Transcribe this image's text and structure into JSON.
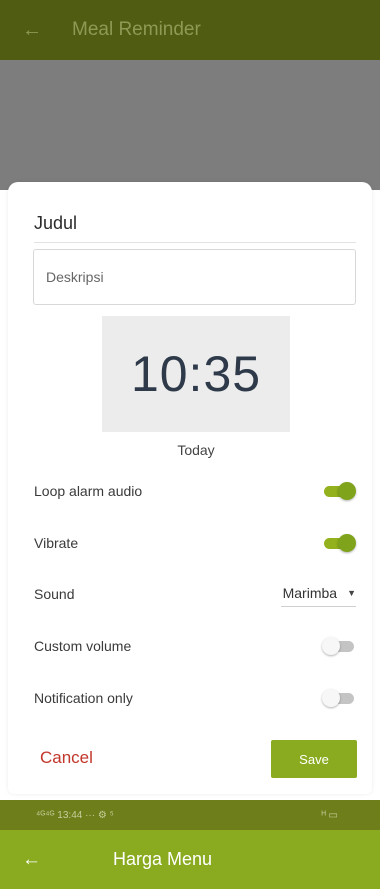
{
  "header": {
    "back_icon": "arrow-left-icon",
    "title": "Meal Reminder"
  },
  "sheet": {
    "title_field": {
      "value": "Judul"
    },
    "description_field": {
      "placeholder": "Deskripsi"
    },
    "time": {
      "value": "10:35",
      "date_label": "Today"
    },
    "settings": {
      "loop_alarm": {
        "label": "Loop alarm audio",
        "on": true
      },
      "vibrate": {
        "label": "Vibrate",
        "on": true
      },
      "sound": {
        "label": "Sound",
        "value": "Marimba"
      },
      "custom_volume": {
        "label": "Custom volume",
        "on": false
      },
      "notification_only": {
        "label": "Notification only",
        "on": false
      }
    },
    "actions": {
      "cancel_label": "Cancel",
      "save_label": "Save"
    }
  },
  "status_bar": {
    "signal_time": "⁴ᴳ⁴ᴳ 13:44 ··· ⚙ ⁵",
    "battery": "ᴴ ▭"
  },
  "bottom_bar": {
    "back_icon": "arrow-left-icon",
    "title": "Harga Menu"
  },
  "colors": {
    "accent": "#8aab1f",
    "accent_dark": "#4f5c12",
    "cancel": "#c2362b",
    "scrim": "#7d7d7d"
  }
}
